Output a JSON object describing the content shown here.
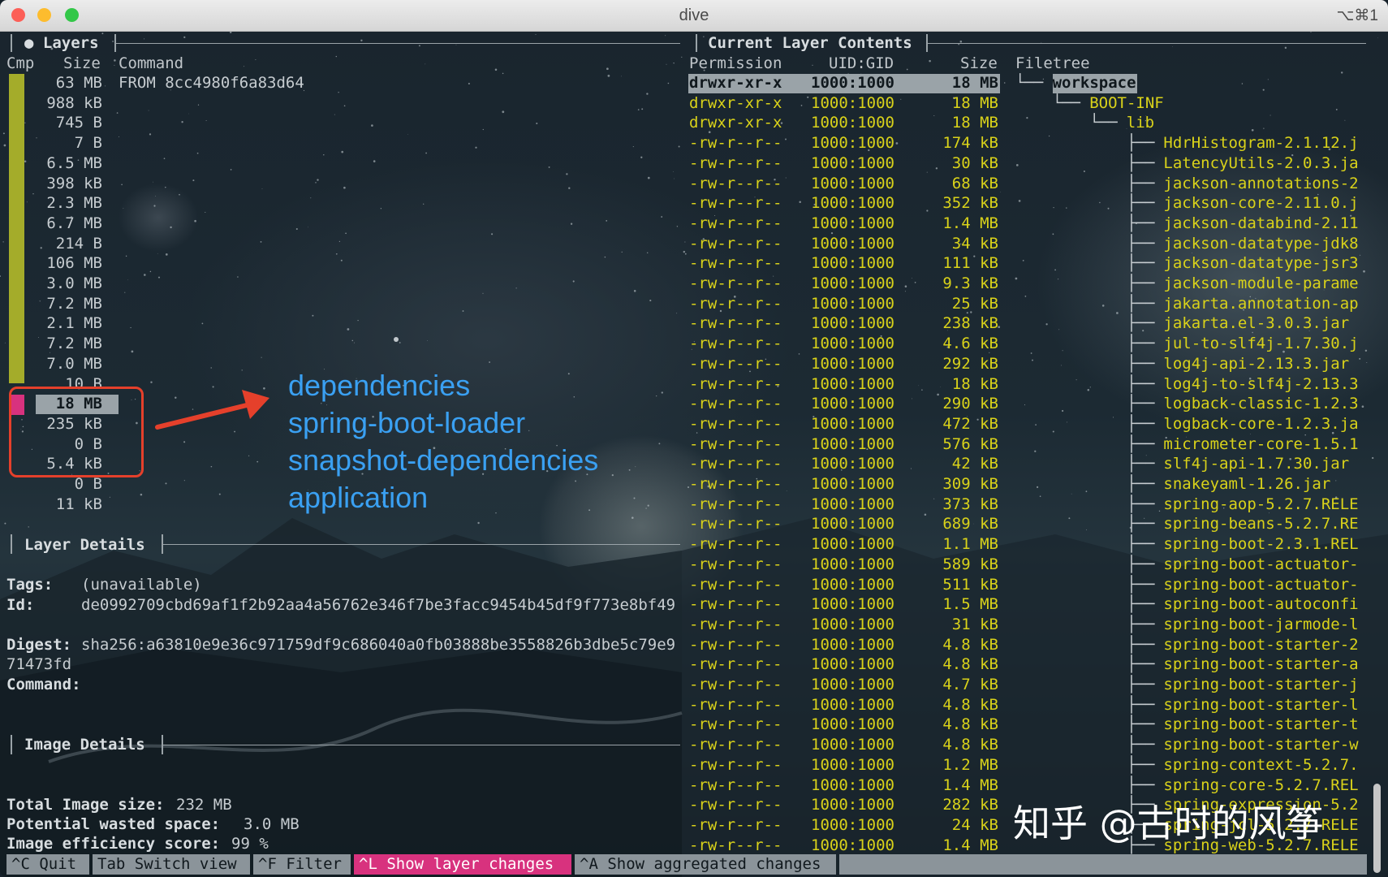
{
  "window": {
    "title": "dive",
    "shortcut": "⌥⌘1",
    "colors": {
      "close": "#fc5f57",
      "minimize": "#fdbc2e",
      "zoom": "#33c748"
    }
  },
  "layers": {
    "title": "● Layers",
    "headers": {
      "cmp": "Cmp",
      "size": "Size",
      "command": "Command"
    },
    "rows": [
      {
        "size": "63 MB",
        "command": "FROM 8cc4980f6a83d64"
      },
      {
        "size": "988 kB",
        "command": ""
      },
      {
        "size": "745 B",
        "command": ""
      },
      {
        "size": "7 B",
        "command": ""
      },
      {
        "size": "6.5 MB",
        "command": ""
      },
      {
        "size": "398 kB",
        "command": ""
      },
      {
        "size": "2.3 MB",
        "command": ""
      },
      {
        "size": "6.7 MB",
        "command": ""
      },
      {
        "size": "214 B",
        "command": ""
      },
      {
        "size": "106 MB",
        "command": ""
      },
      {
        "size": "3.0 MB",
        "command": ""
      },
      {
        "size": "7.2 MB",
        "command": ""
      },
      {
        "size": "2.1 MB",
        "command": ""
      },
      {
        "size": "7.2 MB",
        "command": ""
      },
      {
        "size": "7.0 MB",
        "command": ""
      },
      {
        "size": "10 B",
        "command": ""
      },
      {
        "size": "18 MB",
        "command": "",
        "selected": true
      },
      {
        "size": "235 kB",
        "command": ""
      },
      {
        "size": "0 B",
        "command": ""
      },
      {
        "size": "5.4 kB",
        "command": ""
      },
      {
        "size": "0 B",
        "command": ""
      },
      {
        "size": "11 kB",
        "command": ""
      }
    ],
    "cmp_colors": {
      "bar": "#a4ac2a",
      "selected": "#d8327e"
    }
  },
  "annotation": {
    "lines": [
      "dependencies",
      "spring-boot-loader",
      "snapshot-dependencies",
      "application"
    ],
    "color": "#3aa0f2",
    "highlight_color": "#e5402b"
  },
  "layer_details": {
    "title": "Layer Details",
    "tags_label": "Tags:",
    "tags_value": "(unavailable)",
    "id_label": "Id:",
    "id_value": "de0992709cbd69af1f2b92aa4a56762e346f7be3facc9454b45df9f773e8bf49",
    "digest_label": "Digest:",
    "digest_value": "sha256:a63810e9e36c971759df9c686040a0fb03888be3558826b3dbe5c79e9",
    "digest_value_cont": "71473fd",
    "command_label": "Command:"
  },
  "image_details": {
    "title": "Image Details",
    "total_label": "Total Image size:",
    "total_value": "232 MB",
    "wasted_label": "Potential wasted space:",
    "wasted_value": "3.0 MB",
    "efficiency_label": "Image efficiency score:",
    "efficiency_value": "99 %"
  },
  "contents": {
    "title": "Current Layer Contents",
    "headers": {
      "permission": "Permission",
      "uid": "UID:GID",
      "size": "Size",
      "filetree": "Filetree"
    },
    "rows": [
      {
        "perm": "drwxr-xr-x",
        "uid": "1000:1000",
        "size": "18 MB",
        "tree": "└── ",
        "name": "workspace",
        "selected": true
      },
      {
        "perm": "drwxr-xr-x",
        "uid": "1000:1000",
        "size": "18 MB",
        "tree": "    └── ",
        "name": "BOOT-INF"
      },
      {
        "perm": "drwxr-xr-x",
        "uid": "1000:1000",
        "size": "18 MB",
        "tree": "        └── ",
        "name": "lib"
      },
      {
        "perm": "-rw-r--r--",
        "uid": "1000:1000",
        "size": "174 kB",
        "tree": "            ├── ",
        "name": "HdrHistogram-2.1.12.j"
      },
      {
        "perm": "-rw-r--r--",
        "uid": "1000:1000",
        "size": "30 kB",
        "tree": "            ├── ",
        "name": "LatencyUtils-2.0.3.ja"
      },
      {
        "perm": "-rw-r--r--",
        "uid": "1000:1000",
        "size": "68 kB",
        "tree": "            ├── ",
        "name": "jackson-annotations-2"
      },
      {
        "perm": "-rw-r--r--",
        "uid": "1000:1000",
        "size": "352 kB",
        "tree": "            ├── ",
        "name": "jackson-core-2.11.0.j"
      },
      {
        "perm": "-rw-r--r--",
        "uid": "1000:1000",
        "size": "1.4 MB",
        "tree": "            ├── ",
        "name": "jackson-databind-2.11"
      },
      {
        "perm": "-rw-r--r--",
        "uid": "1000:1000",
        "size": "34 kB",
        "tree": "            ├── ",
        "name": "jackson-datatype-jdk8"
      },
      {
        "perm": "-rw-r--r--",
        "uid": "1000:1000",
        "size": "111 kB",
        "tree": "            ├── ",
        "name": "jackson-datatype-jsr3"
      },
      {
        "perm": "-rw-r--r--",
        "uid": "1000:1000",
        "size": "9.3 kB",
        "tree": "            ├── ",
        "name": "jackson-module-parame"
      },
      {
        "perm": "-rw-r--r--",
        "uid": "1000:1000",
        "size": "25 kB",
        "tree": "            ├── ",
        "name": "jakarta.annotation-ap"
      },
      {
        "perm": "-rw-r--r--",
        "uid": "1000:1000",
        "size": "238 kB",
        "tree": "            ├── ",
        "name": "jakarta.el-3.0.3.jar"
      },
      {
        "perm": "-rw-r--r--",
        "uid": "1000:1000",
        "size": "4.6 kB",
        "tree": "            ├── ",
        "name": "jul-to-slf4j-1.7.30.j"
      },
      {
        "perm": "-rw-r--r--",
        "uid": "1000:1000",
        "size": "292 kB",
        "tree": "            ├── ",
        "name": "log4j-api-2.13.3.jar"
      },
      {
        "perm": "-rw-r--r--",
        "uid": "1000:1000",
        "size": "18 kB",
        "tree": "            ├── ",
        "name": "log4j-to-slf4j-2.13.3"
      },
      {
        "perm": "-rw-r--r--",
        "uid": "1000:1000",
        "size": "290 kB",
        "tree": "            ├── ",
        "name": "logback-classic-1.2.3"
      },
      {
        "perm": "-rw-r--r--",
        "uid": "1000:1000",
        "size": "472 kB",
        "tree": "            ├── ",
        "name": "logback-core-1.2.3.ja"
      },
      {
        "perm": "-rw-r--r--",
        "uid": "1000:1000",
        "size": "576 kB",
        "tree": "            ├── ",
        "name": "micrometer-core-1.5.1"
      },
      {
        "perm": "-rw-r--r--",
        "uid": "1000:1000",
        "size": "42 kB",
        "tree": "            ├── ",
        "name": "slf4j-api-1.7.30.jar"
      },
      {
        "perm": "-rw-r--r--",
        "uid": "1000:1000",
        "size": "309 kB",
        "tree": "            ├── ",
        "name": "snakeyaml-1.26.jar"
      },
      {
        "perm": "-rw-r--r--",
        "uid": "1000:1000",
        "size": "373 kB",
        "tree": "            ├── ",
        "name": "spring-aop-5.2.7.RELE"
      },
      {
        "perm": "-rw-r--r--",
        "uid": "1000:1000",
        "size": "689 kB",
        "tree": "            ├── ",
        "name": "spring-beans-5.2.7.RE"
      },
      {
        "perm": "-rw-r--r--",
        "uid": "1000:1000",
        "size": "1.1 MB",
        "tree": "            ├── ",
        "name": "spring-boot-2.3.1.REL"
      },
      {
        "perm": "-rw-r--r--",
        "uid": "1000:1000",
        "size": "589 kB",
        "tree": "            ├── ",
        "name": "spring-boot-actuator-"
      },
      {
        "perm": "-rw-r--r--",
        "uid": "1000:1000",
        "size": "511 kB",
        "tree": "            ├── ",
        "name": "spring-boot-actuator-"
      },
      {
        "perm": "-rw-r--r--",
        "uid": "1000:1000",
        "size": "1.5 MB",
        "tree": "            ├── ",
        "name": "spring-boot-autoconfi"
      },
      {
        "perm": "-rw-r--r--",
        "uid": "1000:1000",
        "size": "31 kB",
        "tree": "            ├── ",
        "name": "spring-boot-jarmode-l"
      },
      {
        "perm": "-rw-r--r--",
        "uid": "1000:1000",
        "size": "4.8 kB",
        "tree": "            ├── ",
        "name": "spring-boot-starter-2"
      },
      {
        "perm": "-rw-r--r--",
        "uid": "1000:1000",
        "size": "4.8 kB",
        "tree": "            ├── ",
        "name": "spring-boot-starter-a"
      },
      {
        "perm": "-rw-r--r--",
        "uid": "1000:1000",
        "size": "4.7 kB",
        "tree": "            ├── ",
        "name": "spring-boot-starter-j"
      },
      {
        "perm": "-rw-r--r--",
        "uid": "1000:1000",
        "size": "4.8 kB",
        "tree": "            ├── ",
        "name": "spring-boot-starter-l"
      },
      {
        "perm": "-rw-r--r--",
        "uid": "1000:1000",
        "size": "4.8 kB",
        "tree": "            ├── ",
        "name": "spring-boot-starter-t"
      },
      {
        "perm": "-rw-r--r--",
        "uid": "1000:1000",
        "size": "4.8 kB",
        "tree": "            ├── ",
        "name": "spring-boot-starter-w"
      },
      {
        "perm": "-rw-r--r--",
        "uid": "1000:1000",
        "size": "1.2 MB",
        "tree": "            ├── ",
        "name": "spring-context-5.2.7."
      },
      {
        "perm": "-rw-r--r--",
        "uid": "1000:1000",
        "size": "1.4 MB",
        "tree": "            ├── ",
        "name": "spring-core-5.2.7.REL"
      },
      {
        "perm": "-rw-r--r--",
        "uid": "1000:1000",
        "size": "282 kB",
        "tree": "            ├── ",
        "name": "spring-expression-5.2"
      },
      {
        "perm": "-rw-r--r--",
        "uid": "1000:1000",
        "size": "24 kB",
        "tree": "            ├── ",
        "name": "spring-jcl-5.2.7.RELE"
      },
      {
        "perm": "-rw-r--r--",
        "uid": "1000:1000",
        "size": "1.4 MB",
        "tree": "            ├── ",
        "name": "spring-web-5.2.7.RELE"
      }
    ]
  },
  "statusbar": {
    "items": [
      {
        "label": "^C Quit",
        "active": false
      },
      {
        "label": "Tab Switch view",
        "active": false
      },
      {
        "label": "^F Filter",
        "active": false
      },
      {
        "label": "^L Show layer changes",
        "active": true
      },
      {
        "label": "^A Show aggregated changes",
        "active": false
      }
    ]
  },
  "watermark": "知乎 @古时的风筝"
}
